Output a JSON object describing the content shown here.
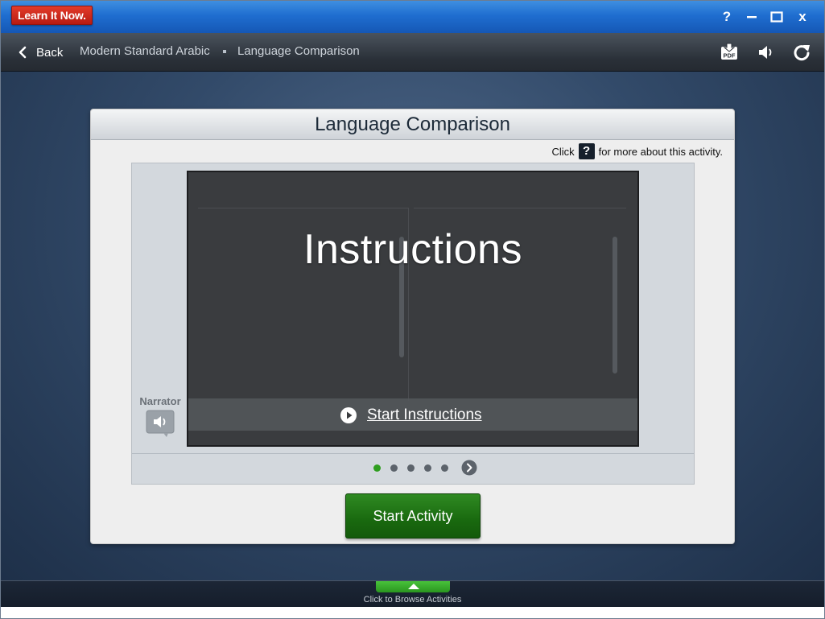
{
  "app": {
    "logo": "Learn It Now.",
    "window_controls": {
      "help": "?",
      "minimize": "—",
      "maximize": "☐",
      "close": "x"
    }
  },
  "nav": {
    "back_label": "Back",
    "breadcrumb": [
      "Modern Standard Arabic",
      "Language Comparison"
    ],
    "icons": [
      "pdf-icon",
      "speaker-icon",
      "refresh-icon"
    ]
  },
  "panel": {
    "title": "Language Comparison",
    "help_prefix": "Click",
    "help_q": "?",
    "help_suffix": "for more about this activity."
  },
  "preview": {
    "heading": "Instructions",
    "start_label": "Start Instructions"
  },
  "narrator": {
    "label": "Narrator"
  },
  "pager": {
    "count": 5,
    "active_index": 0
  },
  "start_activity_label": "Start Activity",
  "bottom": {
    "browse_label": "Click to Browse Activities"
  },
  "colors": {
    "accent_green": "#2f9e1f",
    "title_blue": "#1f6ed0",
    "logo_red": "#d1261a"
  }
}
